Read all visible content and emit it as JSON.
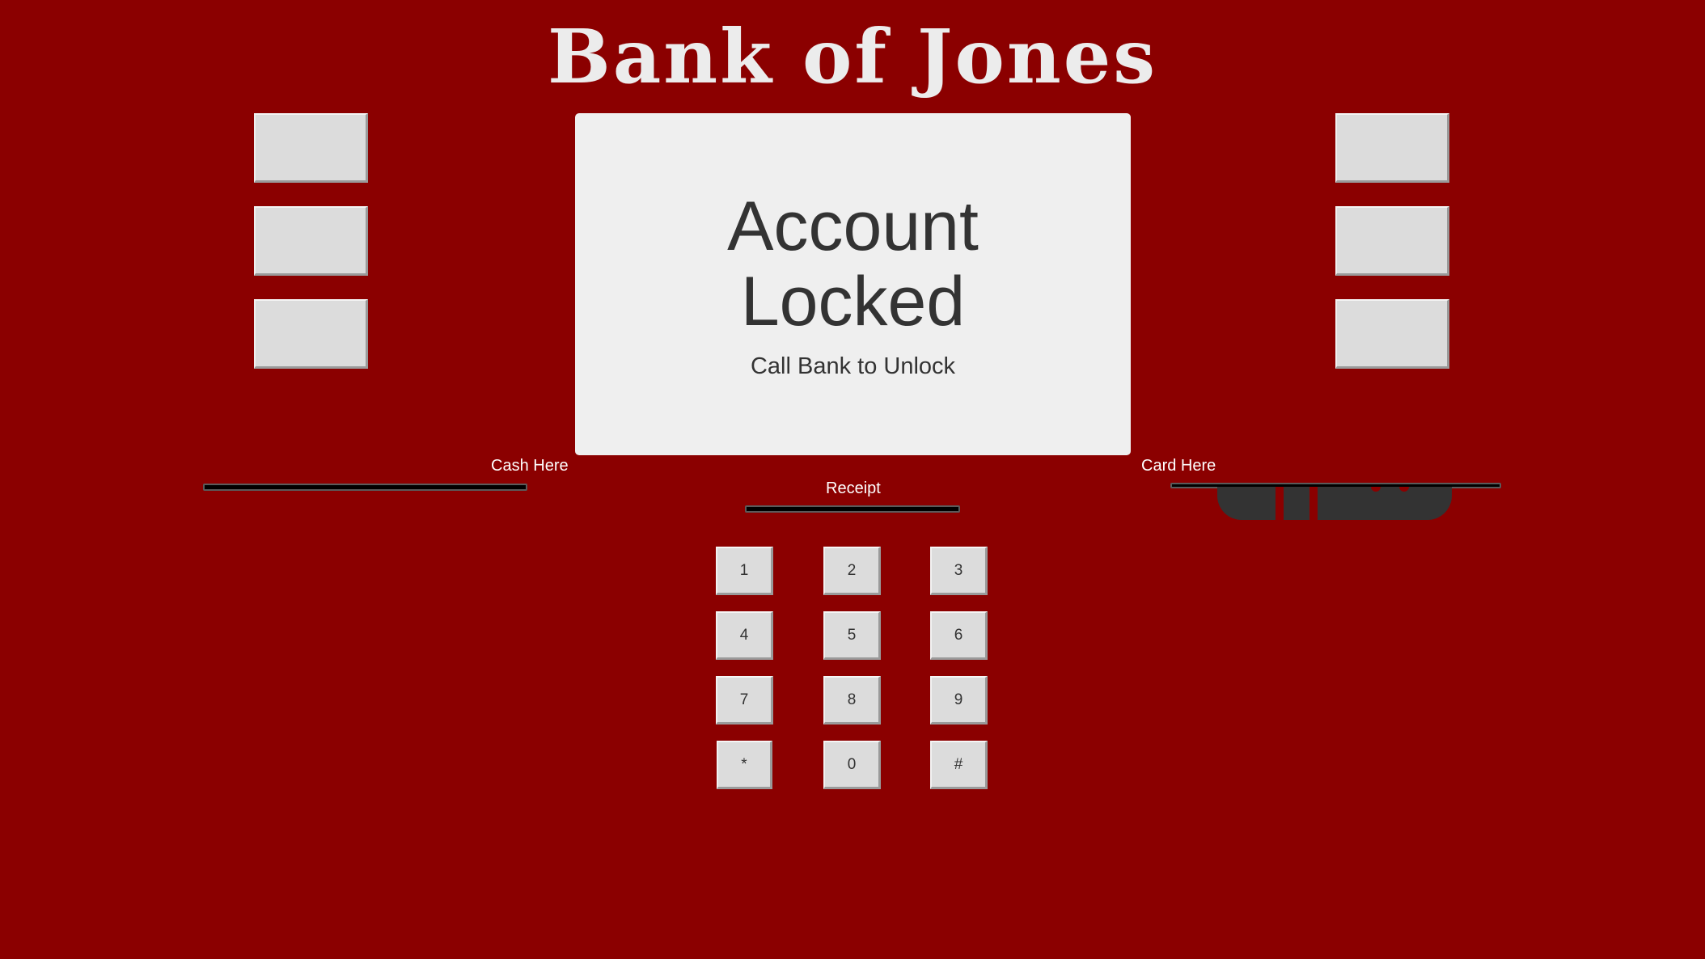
{
  "atm": {
    "bank_name": "Bank of Jones"
  },
  "screen": {
    "heading_line1": "Account",
    "heading_line2": "Locked",
    "message": "Call Bank to Unlock"
  },
  "slots": {
    "cash_label": "Cash Here",
    "receipt_label": "Receipt",
    "card_label": "Card Here"
  },
  "keypad": {
    "keys": [
      "1",
      "2",
      "3",
      "4",
      "5",
      "6",
      "7",
      "8",
      "9",
      "*",
      "0",
      "#"
    ]
  },
  "colors": {
    "background": "#8b0000",
    "screen": "#efefef",
    "button": "#dcdcdc",
    "text_dark": "#333333",
    "title": "#ececec"
  }
}
